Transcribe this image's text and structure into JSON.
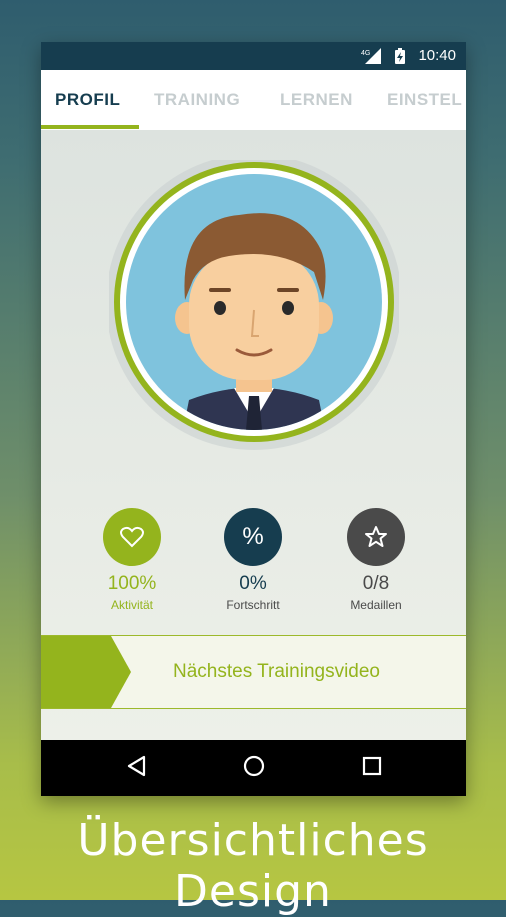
{
  "status_bar": {
    "network": "4G",
    "time": "10:40"
  },
  "tabs": [
    {
      "label": "PROFIL",
      "active": true
    },
    {
      "label": "TRAINING",
      "active": false
    },
    {
      "label": "LERNEN",
      "active": false
    },
    {
      "label": "EINSTEL",
      "active": false
    }
  ],
  "stats": [
    {
      "value": "100%",
      "label": "Aktivität",
      "icon": "heart-icon",
      "color": "#94b41d"
    },
    {
      "value": "0%",
      "label": "Fortschritt",
      "icon": "%",
      "color": "#163d4f"
    },
    {
      "value": "0/8",
      "label": "Medaillen",
      "icon": "star-icon",
      "color": "#4a4a4a"
    }
  ],
  "next_video": {
    "label": "Nächstes Trainingsvideo"
  },
  "nav_bar": {
    "back": "back-icon",
    "home": "home-icon",
    "recents": "recents-icon"
  },
  "caption": "Übersichtliches Design",
  "colors": {
    "accent": "#94b41d",
    "dark": "#163d4f",
    "avatar_bg": "#7fc3dd"
  }
}
